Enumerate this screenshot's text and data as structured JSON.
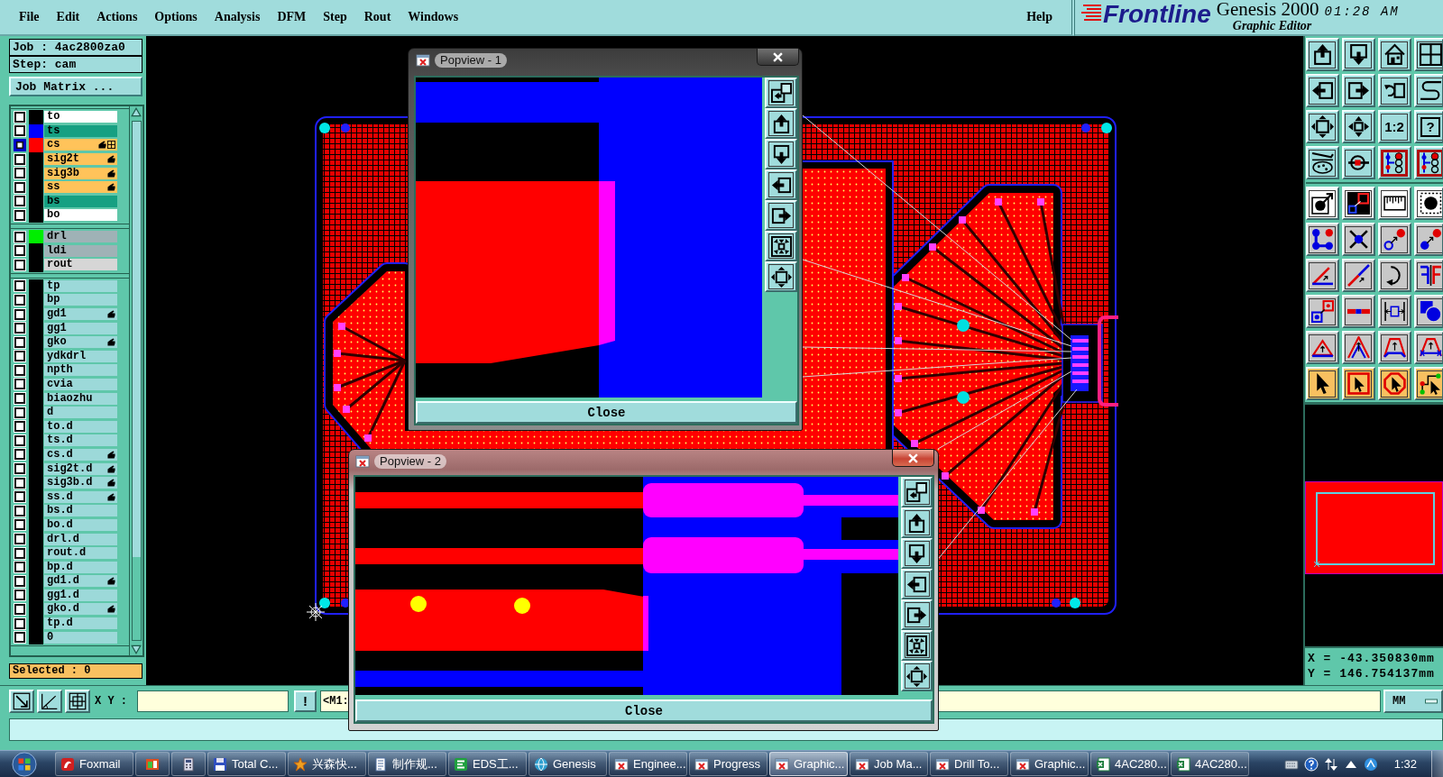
{
  "menu_bar": {
    "items": [
      "File",
      "Edit",
      "Actions",
      "Options",
      "Analysis",
      "DFM",
      "Step",
      "Rout",
      "Windows"
    ],
    "help": "Help"
  },
  "branding": {
    "logo": "Frontline",
    "product": "Genesis 2000",
    "time": "01:28 AM",
    "subtitle": "Graphic Editor"
  },
  "job_panel": {
    "job": "Job : 4ac2800za0",
    "step": "Step: cam",
    "matrix_button": "Job Matrix ...",
    "layer_groups": [
      {
        "layers": [
          {
            "name": "to",
            "kind": "silk",
            "selected": false,
            "edit_mark": false,
            "work_layer": false
          },
          {
            "name": "ts",
            "kind": "mask",
            "color": "#0000ff",
            "selected": false,
            "edit_mark": false,
            "work_layer": false
          },
          {
            "name": "cs",
            "kind": "signal",
            "color": "#ff0000",
            "selected": true,
            "edit_mark": true,
            "work_layer": true
          },
          {
            "name": "sig2t",
            "kind": "signal",
            "selected": false,
            "edit_mark": true,
            "work_layer": false
          },
          {
            "name": "sig3b",
            "kind": "signal",
            "selected": false,
            "edit_mark": true,
            "work_layer": false
          },
          {
            "name": "ss",
            "kind": "signal",
            "selected": false,
            "edit_mark": true,
            "work_layer": false
          },
          {
            "name": "bs",
            "kind": "mask",
            "selected": false,
            "edit_mark": false,
            "work_layer": false
          },
          {
            "name": "bo",
            "kind": "silk",
            "selected": false,
            "edit_mark": false,
            "work_layer": false
          }
        ]
      },
      {
        "layers": [
          {
            "name": "drl",
            "kind": "drill",
            "color": "#00ee00",
            "selected": false,
            "edit_mark": false,
            "work_layer": false
          },
          {
            "name": "ldi",
            "kind": "drill",
            "selected": false,
            "edit_mark": false,
            "work_layer": false
          },
          {
            "name": "rout",
            "kind": "rout",
            "selected": false,
            "edit_mark": false,
            "work_layer": false
          }
        ]
      },
      {
        "layers": [
          {
            "name": "tp",
            "kind": "misc",
            "selected": false,
            "edit_mark": false,
            "work_layer": false
          },
          {
            "name": "bp",
            "kind": "misc",
            "selected": false,
            "edit_mark": false,
            "work_layer": false
          },
          {
            "name": "gd1",
            "kind": "misc",
            "selected": false,
            "edit_mark": true,
            "work_layer": false
          },
          {
            "name": "gg1",
            "kind": "misc",
            "selected": false,
            "edit_mark": false,
            "work_layer": false
          },
          {
            "name": "gko",
            "kind": "misc",
            "selected": false,
            "edit_mark": true,
            "work_layer": false
          },
          {
            "name": "ydkdrl",
            "kind": "misc",
            "selected": false,
            "edit_mark": false,
            "work_layer": false
          },
          {
            "name": "npth",
            "kind": "misc",
            "selected": false,
            "edit_mark": false,
            "work_layer": false
          },
          {
            "name": "cvia",
            "kind": "misc",
            "selected": false,
            "edit_mark": false,
            "work_layer": false
          },
          {
            "name": "biaozhu",
            "kind": "misc",
            "selected": false,
            "edit_mark": false,
            "work_layer": false
          },
          {
            "name": "d",
            "kind": "misc",
            "selected": false,
            "edit_mark": false,
            "work_layer": false
          },
          {
            "name": "to.d",
            "kind": "misc",
            "selected": false,
            "edit_mark": false,
            "work_layer": false
          },
          {
            "name": "ts.d",
            "kind": "misc",
            "selected": false,
            "edit_mark": false,
            "work_layer": false
          },
          {
            "name": "cs.d",
            "kind": "misc",
            "selected": false,
            "edit_mark": true,
            "work_layer": false
          },
          {
            "name": "sig2t.d",
            "kind": "misc",
            "selected": false,
            "edit_mark": true,
            "work_layer": false
          },
          {
            "name": "sig3b.d",
            "kind": "misc",
            "selected": false,
            "edit_mark": true,
            "work_layer": false
          },
          {
            "name": "ss.d",
            "kind": "misc",
            "selected": false,
            "edit_mark": true,
            "work_layer": false
          },
          {
            "name": "bs.d",
            "kind": "misc",
            "selected": false,
            "edit_mark": false,
            "work_layer": false
          },
          {
            "name": "bo.d",
            "kind": "misc",
            "selected": false,
            "edit_mark": false,
            "work_layer": false
          },
          {
            "name": "drl.d",
            "kind": "misc",
            "selected": false,
            "edit_mark": false,
            "work_layer": false
          },
          {
            "name": "rout.d",
            "kind": "misc",
            "selected": false,
            "edit_mark": false,
            "work_layer": false
          },
          {
            "name": "bp.d",
            "kind": "misc",
            "selected": false,
            "edit_mark": false,
            "work_layer": false
          },
          {
            "name": "gd1.d",
            "kind": "misc",
            "selected": false,
            "edit_mark": true,
            "work_layer": false
          },
          {
            "name": "gg1.d",
            "kind": "misc",
            "selected": false,
            "edit_mark": false,
            "work_layer": false
          },
          {
            "name": "gko.d",
            "kind": "misc",
            "selected": false,
            "edit_mark": true,
            "work_layer": false
          },
          {
            "name": "tp.d",
            "kind": "misc",
            "selected": false,
            "edit_mark": false,
            "work_layer": false
          },
          {
            "name": "0",
            "kind": "misc",
            "selected": false,
            "edit_mark": false,
            "work_layer": false
          }
        ]
      }
    ],
    "selected_count": "Selected : 0"
  },
  "popviews": [
    {
      "title": "Popview - 1",
      "close_button": "Close",
      "active": false
    },
    {
      "title": "Popview - 2",
      "close_button": "Close",
      "active": true
    }
  ],
  "toolbar": {
    "groups": [
      {
        "kind": "view",
        "buttons": [
          {
            "selected": false
          },
          {
            "selected": false
          },
          {
            "selected": false
          },
          {
            "selected": false
          },
          {
            "selected": false
          },
          {
            "selected": false
          },
          {
            "selected": false
          },
          {
            "selected": false
          },
          {
            "selected": false
          },
          {
            "selected": false
          },
          {
            "label": "1:2",
            "selected": false
          },
          {
            "label": "?",
            "selected": false
          },
          {
            "selected": false
          },
          {
            "selected": false
          },
          {
            "selected": true
          },
          {
            "selected": true
          }
        ]
      },
      {
        "kind": "toggle",
        "buttons": [
          {
            "selected": false
          },
          {
            "selected": false
          },
          {
            "selected": false
          },
          {
            "selected": false
          }
        ]
      },
      {
        "kind": "edit",
        "buttons": [
          {
            "selected": false
          },
          {
            "selected": false
          },
          {
            "selected": false
          },
          {
            "selected": false
          },
          {
            "selected": false
          },
          {
            "selected": false
          },
          {
            "selected": false
          },
          {
            "selected": false
          },
          {
            "selected": false
          },
          {
            "selected": false
          },
          {
            "selected": false
          },
          {
            "selected": false
          },
          {
            "selected": false
          },
          {
            "selected": false
          },
          {
            "selected": false
          },
          {
            "selected": false
          }
        ]
      },
      {
        "kind": "select",
        "buttons": [
          {
            "selected": false
          },
          {
            "selected": false
          },
          {
            "selected": false
          },
          {
            "selected": false
          }
        ]
      }
    ]
  },
  "coordinates": {
    "x": "X = -43.350830mm",
    "y": "Y = 146.754137mm"
  },
  "command_bar": {
    "label": "X Y :",
    "alert_button": "!",
    "message": "<M1:",
    "units": "MM"
  },
  "taskbar": {
    "items": [
      {
        "kind": "mail",
        "label": "Foxmail",
        "selected": false
      },
      {
        "kind": "slides",
        "selected": false
      },
      {
        "kind": "calculator",
        "selected": false
      },
      {
        "kind": "disk",
        "label": "Total C...",
        "selected": false
      },
      {
        "kind": "star",
        "label": "兴森快...",
        "selected": false
      },
      {
        "kind": "document",
        "label": "制作规...",
        "selected": false
      },
      {
        "kind": "eds",
        "label": "EDS工...",
        "selected": false
      },
      {
        "kind": "genesis",
        "label": "Genesis",
        "selected": false
      },
      {
        "kind": "window",
        "label": "Enginee...",
        "selected": false
      },
      {
        "kind": "window",
        "label": "Progress",
        "selected": false
      },
      {
        "kind": "window",
        "label": "Graphic...",
        "selected": true
      },
      {
        "kind": "window",
        "label": "Job Ma...",
        "selected": false
      },
      {
        "kind": "window",
        "label": "Drill To...",
        "selected": false
      },
      {
        "kind": "window",
        "label": "Graphic...",
        "selected": false
      },
      {
        "kind": "sheet",
        "label": "4AC280...",
        "selected": false
      },
      {
        "kind": "sheet",
        "label": "4AC280...",
        "selected": false
      }
    ],
    "clock": "1:32"
  }
}
